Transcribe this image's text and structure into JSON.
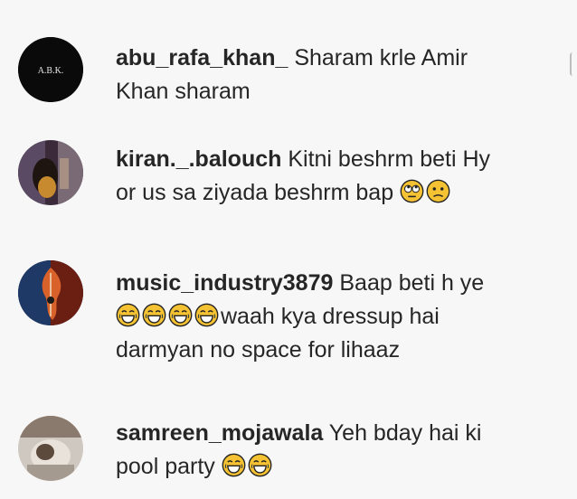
{
  "comments": [
    {
      "avatar_icon": "abk-logo-avatar-icon",
      "avatar_text": "A.B.K.",
      "username": "abu_rafa_khan_",
      "line1": "Sharam krle Amir",
      "line2": "Khan sharam"
    },
    {
      "avatar_icon": "profile-photo-icon",
      "username": "kiran._.balouch",
      "line1": "Kitni beshrm beti Hy",
      "line2": "or us sa ziyada beshrm bap",
      "emojis": [
        "face-with-rolling-eyes-icon",
        "confused-face-icon"
      ]
    },
    {
      "avatar_icon": "guitar-art-avatar-icon",
      "username": "music_industry3879",
      "line1": "Baap beti h ye",
      "line2": "waah kya dressup hai",
      "line3": "darmyan no space for lihaaz",
      "emojis": [
        "laughing-face-icon",
        "laughing-face-icon",
        "laughing-face-icon",
        "laughing-face-icon"
      ]
    },
    {
      "avatar_icon": "profile-photo-icon",
      "username": "samreen_mojawala",
      "line1": "Yeh bday hai ki",
      "line2": "pool party",
      "emojis": [
        "laughing-face-icon",
        "laughing-face-icon"
      ]
    }
  ],
  "colors": {
    "background": "#f7f7f7",
    "text": "#262626",
    "emoji_yellow": "#f5c233"
  }
}
